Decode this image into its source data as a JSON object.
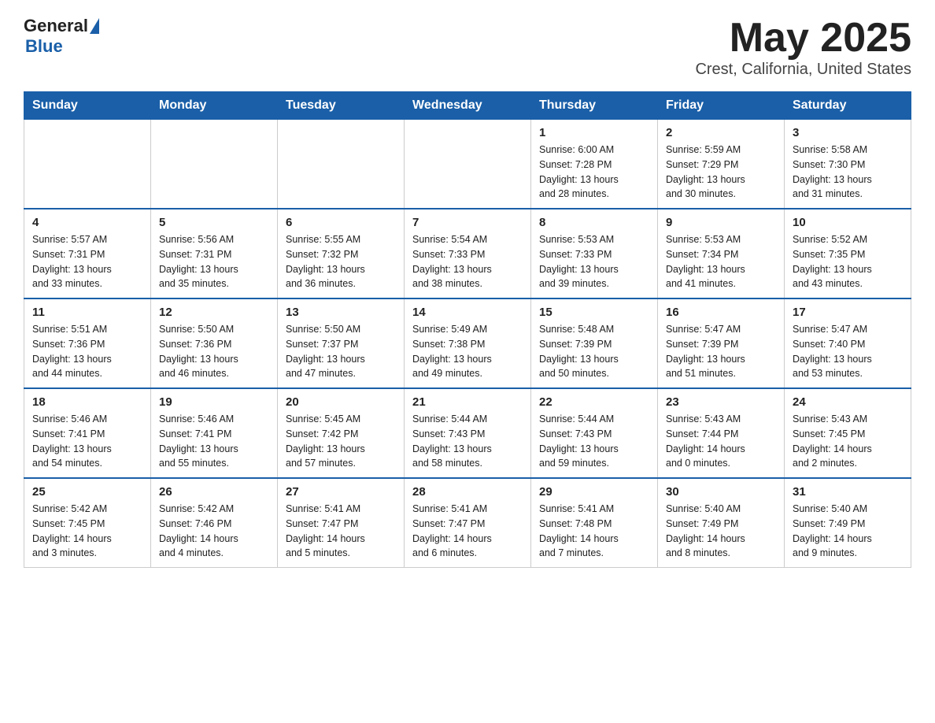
{
  "header": {
    "logo_text_general": "General",
    "logo_text_blue": "Blue",
    "title": "May 2025",
    "subtitle": "Crest, California, United States"
  },
  "weekdays": [
    "Sunday",
    "Monday",
    "Tuesday",
    "Wednesday",
    "Thursday",
    "Friday",
    "Saturday"
  ],
  "weeks": [
    [
      {
        "day": "",
        "info": ""
      },
      {
        "day": "",
        "info": ""
      },
      {
        "day": "",
        "info": ""
      },
      {
        "day": "",
        "info": ""
      },
      {
        "day": "1",
        "info": "Sunrise: 6:00 AM\nSunset: 7:28 PM\nDaylight: 13 hours\nand 28 minutes."
      },
      {
        "day": "2",
        "info": "Sunrise: 5:59 AM\nSunset: 7:29 PM\nDaylight: 13 hours\nand 30 minutes."
      },
      {
        "day": "3",
        "info": "Sunrise: 5:58 AM\nSunset: 7:30 PM\nDaylight: 13 hours\nand 31 minutes."
      }
    ],
    [
      {
        "day": "4",
        "info": "Sunrise: 5:57 AM\nSunset: 7:31 PM\nDaylight: 13 hours\nand 33 minutes."
      },
      {
        "day": "5",
        "info": "Sunrise: 5:56 AM\nSunset: 7:31 PM\nDaylight: 13 hours\nand 35 minutes."
      },
      {
        "day": "6",
        "info": "Sunrise: 5:55 AM\nSunset: 7:32 PM\nDaylight: 13 hours\nand 36 minutes."
      },
      {
        "day": "7",
        "info": "Sunrise: 5:54 AM\nSunset: 7:33 PM\nDaylight: 13 hours\nand 38 minutes."
      },
      {
        "day": "8",
        "info": "Sunrise: 5:53 AM\nSunset: 7:33 PM\nDaylight: 13 hours\nand 39 minutes."
      },
      {
        "day": "9",
        "info": "Sunrise: 5:53 AM\nSunset: 7:34 PM\nDaylight: 13 hours\nand 41 minutes."
      },
      {
        "day": "10",
        "info": "Sunrise: 5:52 AM\nSunset: 7:35 PM\nDaylight: 13 hours\nand 43 minutes."
      }
    ],
    [
      {
        "day": "11",
        "info": "Sunrise: 5:51 AM\nSunset: 7:36 PM\nDaylight: 13 hours\nand 44 minutes."
      },
      {
        "day": "12",
        "info": "Sunrise: 5:50 AM\nSunset: 7:36 PM\nDaylight: 13 hours\nand 46 minutes."
      },
      {
        "day": "13",
        "info": "Sunrise: 5:50 AM\nSunset: 7:37 PM\nDaylight: 13 hours\nand 47 minutes."
      },
      {
        "day": "14",
        "info": "Sunrise: 5:49 AM\nSunset: 7:38 PM\nDaylight: 13 hours\nand 49 minutes."
      },
      {
        "day": "15",
        "info": "Sunrise: 5:48 AM\nSunset: 7:39 PM\nDaylight: 13 hours\nand 50 minutes."
      },
      {
        "day": "16",
        "info": "Sunrise: 5:47 AM\nSunset: 7:39 PM\nDaylight: 13 hours\nand 51 minutes."
      },
      {
        "day": "17",
        "info": "Sunrise: 5:47 AM\nSunset: 7:40 PM\nDaylight: 13 hours\nand 53 minutes."
      }
    ],
    [
      {
        "day": "18",
        "info": "Sunrise: 5:46 AM\nSunset: 7:41 PM\nDaylight: 13 hours\nand 54 minutes."
      },
      {
        "day": "19",
        "info": "Sunrise: 5:46 AM\nSunset: 7:41 PM\nDaylight: 13 hours\nand 55 minutes."
      },
      {
        "day": "20",
        "info": "Sunrise: 5:45 AM\nSunset: 7:42 PM\nDaylight: 13 hours\nand 57 minutes."
      },
      {
        "day": "21",
        "info": "Sunrise: 5:44 AM\nSunset: 7:43 PM\nDaylight: 13 hours\nand 58 minutes."
      },
      {
        "day": "22",
        "info": "Sunrise: 5:44 AM\nSunset: 7:43 PM\nDaylight: 13 hours\nand 59 minutes."
      },
      {
        "day": "23",
        "info": "Sunrise: 5:43 AM\nSunset: 7:44 PM\nDaylight: 14 hours\nand 0 minutes."
      },
      {
        "day": "24",
        "info": "Sunrise: 5:43 AM\nSunset: 7:45 PM\nDaylight: 14 hours\nand 2 minutes."
      }
    ],
    [
      {
        "day": "25",
        "info": "Sunrise: 5:42 AM\nSunset: 7:45 PM\nDaylight: 14 hours\nand 3 minutes."
      },
      {
        "day": "26",
        "info": "Sunrise: 5:42 AM\nSunset: 7:46 PM\nDaylight: 14 hours\nand 4 minutes."
      },
      {
        "day": "27",
        "info": "Sunrise: 5:41 AM\nSunset: 7:47 PM\nDaylight: 14 hours\nand 5 minutes."
      },
      {
        "day": "28",
        "info": "Sunrise: 5:41 AM\nSunset: 7:47 PM\nDaylight: 14 hours\nand 6 minutes."
      },
      {
        "day": "29",
        "info": "Sunrise: 5:41 AM\nSunset: 7:48 PM\nDaylight: 14 hours\nand 7 minutes."
      },
      {
        "day": "30",
        "info": "Sunrise: 5:40 AM\nSunset: 7:49 PM\nDaylight: 14 hours\nand 8 minutes."
      },
      {
        "day": "31",
        "info": "Sunrise: 5:40 AM\nSunset: 7:49 PM\nDaylight: 14 hours\nand 9 minutes."
      }
    ]
  ]
}
